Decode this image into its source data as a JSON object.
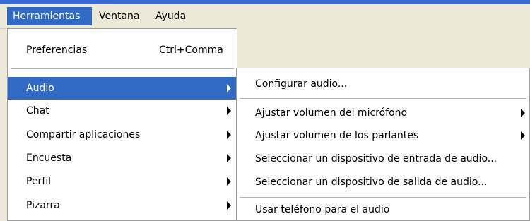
{
  "menubar": {
    "items": [
      {
        "label": "Herramientas"
      },
      {
        "label": "Ventana"
      },
      {
        "label": "Ayuda"
      }
    ]
  },
  "tools_menu": {
    "items": [
      {
        "label": "Preferencias",
        "shortcut": "Ctrl+Comma"
      },
      {
        "label": "Audio"
      },
      {
        "label": "Chat"
      },
      {
        "label": "Compartir aplicaciones"
      },
      {
        "label": "Encuesta"
      },
      {
        "label": "Perfil"
      },
      {
        "label": "Pizarra"
      }
    ]
  },
  "audio_submenu": {
    "items": [
      {
        "label": "Configurar audio..."
      },
      {
        "label": "Ajustar volumen del micrófono"
      },
      {
        "label": "Ajustar volumen de los parlantes"
      },
      {
        "label": "Seleccionar un dispositivo de entrada de audio..."
      },
      {
        "label": "Seleccionar un dispositivo de salida de audio..."
      },
      {
        "label": "Usar teléfono para el audio"
      }
    ]
  },
  "colors": {
    "highlight": "#316ac5",
    "menubar_background": "#ece9d8",
    "menu_background": "#ffffff"
  }
}
